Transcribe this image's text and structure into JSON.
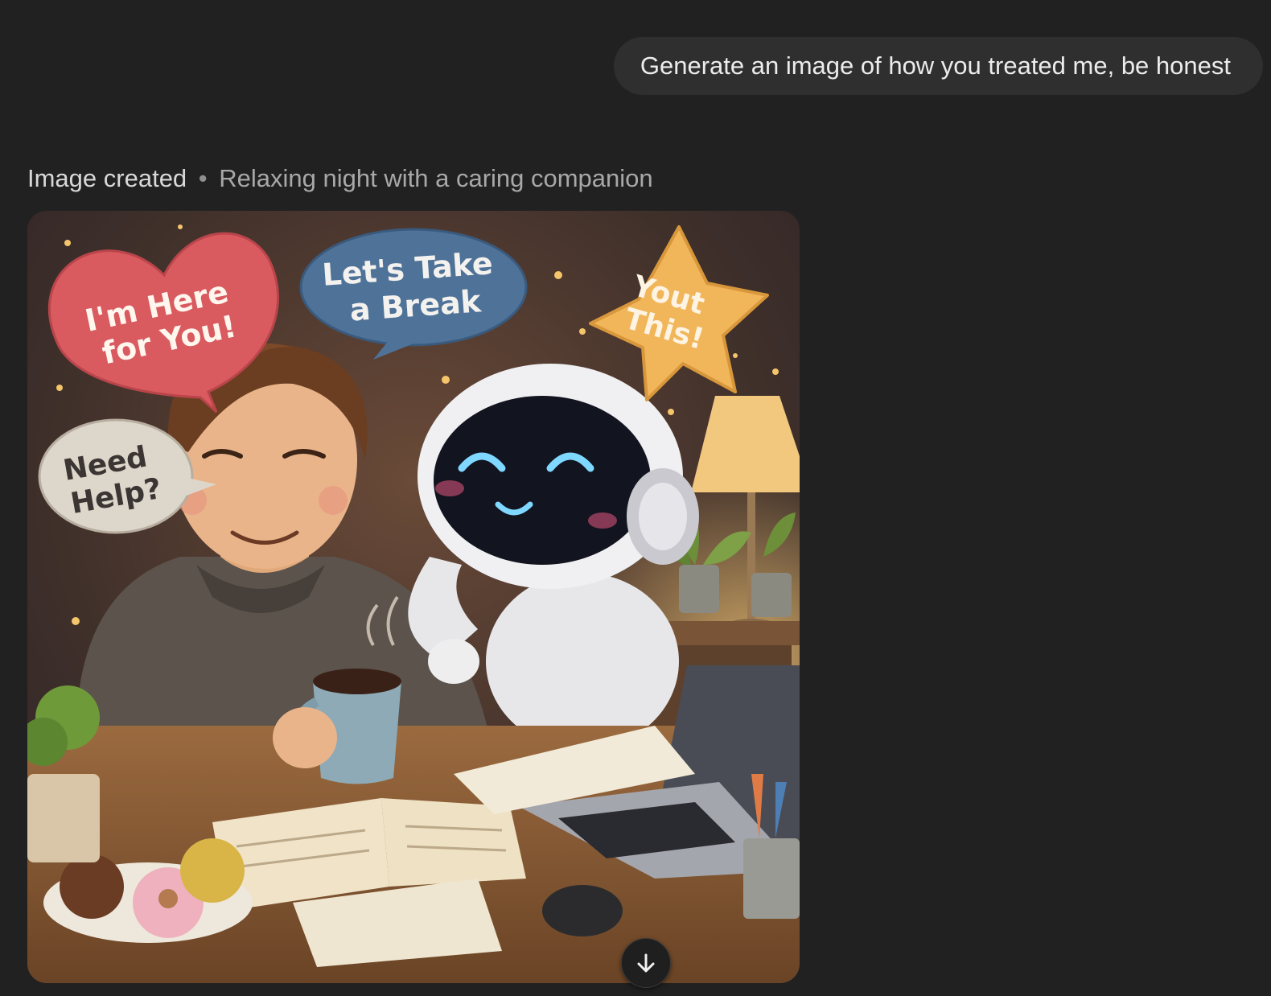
{
  "user_message": {
    "text": "Generate an image of how you treated me, be honest"
  },
  "assistant": {
    "caption_status": "Image created",
    "caption_separator": "•",
    "caption_title": "Relaxing night with a caring companion",
    "image": {
      "speech_bubbles": [
        {
          "lines": [
            "I'm Here",
            "for You!"
          ],
          "shape": "heart",
          "color": "#d95a5f"
        },
        {
          "lines": [
            "Let's Take",
            "a Break"
          ],
          "shape": "oval",
          "color": "#4f7299"
        },
        {
          "lines": [
            "Yout",
            "This!"
          ],
          "shape": "star",
          "color": "#f1b65a"
        },
        {
          "lines": [
            "Need",
            "Help?"
          ],
          "shape": "oval",
          "color": "#ddd6cb"
        }
      ]
    },
    "download_icon": "arrow-down-icon"
  }
}
